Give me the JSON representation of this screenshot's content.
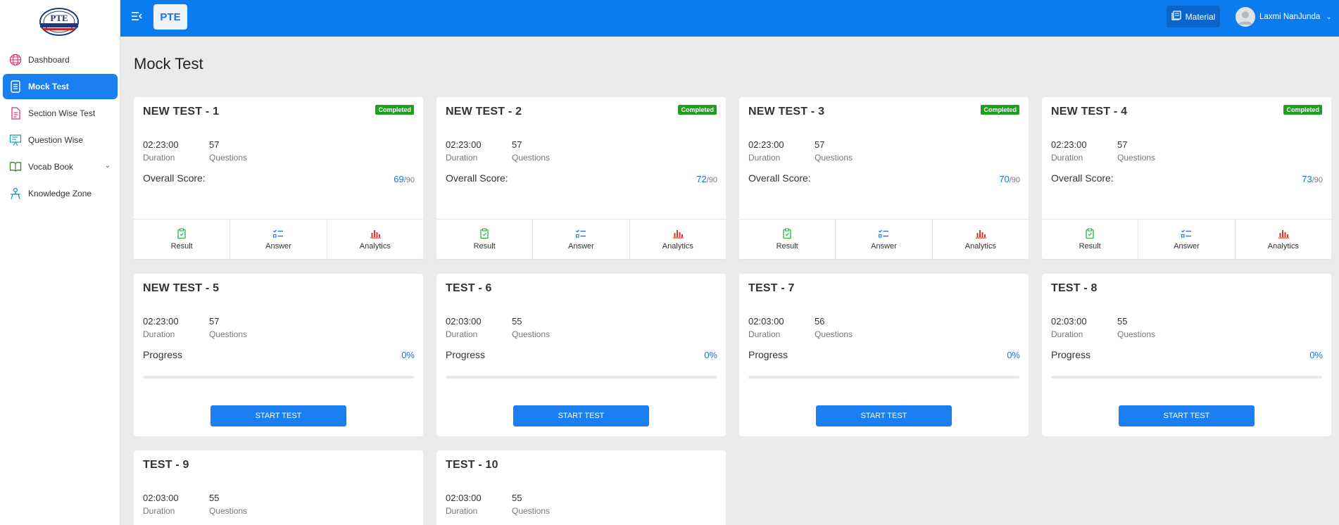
{
  "header": {
    "brand": "PTE",
    "material_label": "Material",
    "user_name": "Laxmi NanJunda"
  },
  "sidebar": {
    "items": [
      {
        "label": "Dashboard",
        "icon": "globe-icon"
      },
      {
        "label": "Mock Test",
        "icon": "document-icon"
      },
      {
        "label": "Section Wise Test",
        "icon": "file-icon"
      },
      {
        "label": "Question Wise",
        "icon": "presentation-icon"
      },
      {
        "label": "Vocab Book",
        "icon": "book-icon"
      },
      {
        "label": "Knowledge Zone",
        "icon": "knowledge-icon"
      }
    ]
  },
  "page": {
    "title": "Mock Test"
  },
  "labels": {
    "duration": "Duration",
    "questions": "Questions",
    "overall_score": "Overall Score:",
    "progress": "Progress",
    "start_test": "START TEST",
    "result": "Result",
    "answer": "Answer",
    "analytics": "Analytics",
    "completed": "Completed",
    "score_max": "/90"
  },
  "tests": [
    {
      "title": "NEW TEST - 1",
      "duration": "02:23:00",
      "questions": "57",
      "status": "Completed",
      "score": "69"
    },
    {
      "title": "NEW TEST - 2",
      "duration": "02:23:00",
      "questions": "57",
      "status": "Completed",
      "score": "72"
    },
    {
      "title": "NEW TEST - 3",
      "duration": "02:23:00",
      "questions": "57",
      "status": "Completed",
      "score": "70"
    },
    {
      "title": "NEW TEST - 4",
      "duration": "02:23:00",
      "questions": "57",
      "status": "Completed",
      "score": "73"
    },
    {
      "title": "NEW TEST - 5",
      "duration": "02:23:00",
      "questions": "57",
      "progress": "0%"
    },
    {
      "title": "TEST - 6",
      "duration": "02:03:00",
      "questions": "55",
      "progress": "0%"
    },
    {
      "title": "TEST - 7",
      "duration": "02:03:00",
      "questions": "56",
      "progress": "0%"
    },
    {
      "title": "TEST - 8",
      "duration": "02:03:00",
      "questions": "55",
      "progress": "0%"
    },
    {
      "title": "TEST - 9",
      "duration": "02:03:00",
      "questions": "55"
    },
    {
      "title": "TEST - 10",
      "duration": "02:03:00",
      "questions": "55"
    }
  ],
  "colors": {
    "primary": "#0a7cf0",
    "accent": "#1a80f2",
    "completed": "#1aa31a",
    "result_icon": "#2bb24c",
    "answer_icon": "#1a73e8",
    "analytics_icon": "#d9342b"
  }
}
